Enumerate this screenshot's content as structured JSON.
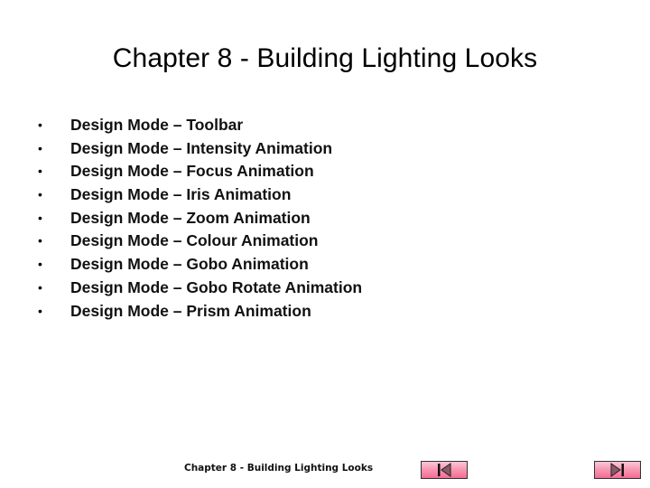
{
  "slide": {
    "title": "Chapter 8 - Building Lighting Looks",
    "bullet_glyph": "•",
    "bullets": [
      "Design Mode – Toolbar",
      "Design Mode – Intensity Animation",
      "Design Mode – Focus Animation",
      "Design Mode – Iris Animation",
      "Design Mode – Zoom Animation",
      "Design Mode – Colour Animation",
      "Design Mode – Gobo Animation",
      "Design Mode – Gobo Rotate Animation",
      "Design Mode – Prism Animation"
    ]
  },
  "footer": {
    "label": "Chapter 8 - Building Lighting Looks",
    "nav": {
      "first": {
        "icon": "skip-to-first-icon"
      },
      "last": {
        "icon": "skip-to-last-icon"
      }
    }
  }
}
